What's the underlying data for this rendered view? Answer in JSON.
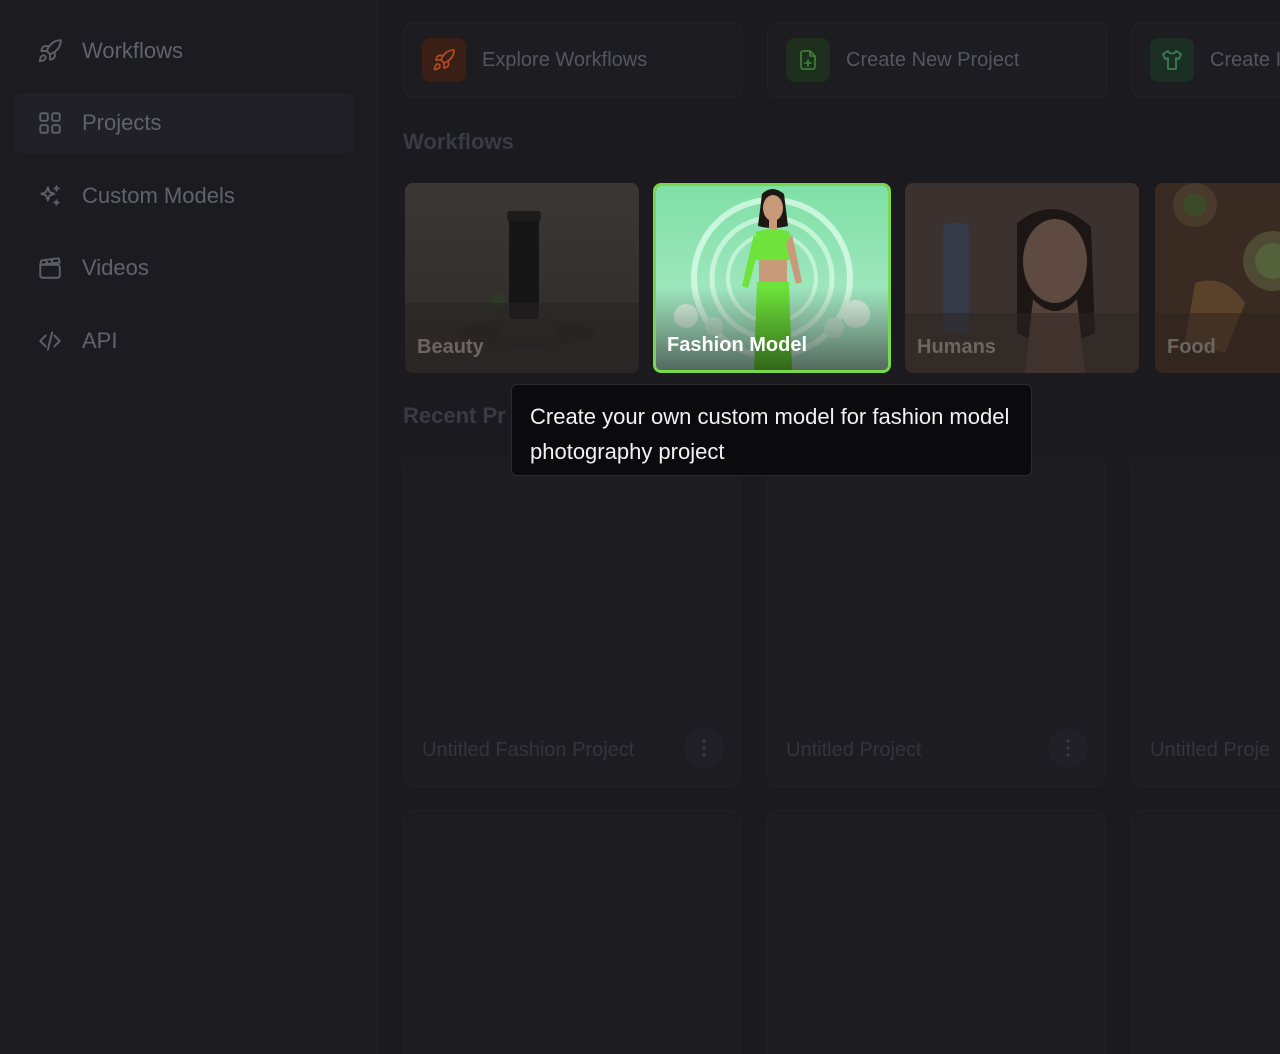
{
  "sidebar": {
    "items": [
      {
        "label": "Workflows",
        "icon": "rocket-icon"
      },
      {
        "label": "Projects",
        "icon": "grid-icon",
        "active": true
      },
      {
        "label": "Custom Models",
        "icon": "sparkle-icon"
      },
      {
        "label": "Videos",
        "icon": "clapperboard-icon"
      },
      {
        "label": "API",
        "icon": "code-icon"
      }
    ]
  },
  "actions": [
    {
      "label": "Explore Workflows",
      "icon": "rocket-icon",
      "color": "#c0542a"
    },
    {
      "label": "Create New Project",
      "icon": "file-plus-icon",
      "color": "#3f8a3f"
    },
    {
      "label": "Create I",
      "icon": "shirt-icon",
      "color": "#3c8a5a"
    }
  ],
  "sections": {
    "workflows_title": "Workflows",
    "recent_title": "Recent Pr"
  },
  "workflows": [
    {
      "label": "Beauty"
    },
    {
      "label": "Fashion Model",
      "highlighted": true
    },
    {
      "label": "Humans"
    },
    {
      "label": "Food"
    }
  ],
  "tooltip": {
    "text": "Create your own custom model for fashion model photography project"
  },
  "projects": [
    {
      "name": "Untitled Fashion Project"
    },
    {
      "name": "Untitled Project"
    },
    {
      "name": "Untitled Proje"
    }
  ],
  "colors": {
    "accent": "#7ad64a",
    "background": "#1a1a1f"
  }
}
